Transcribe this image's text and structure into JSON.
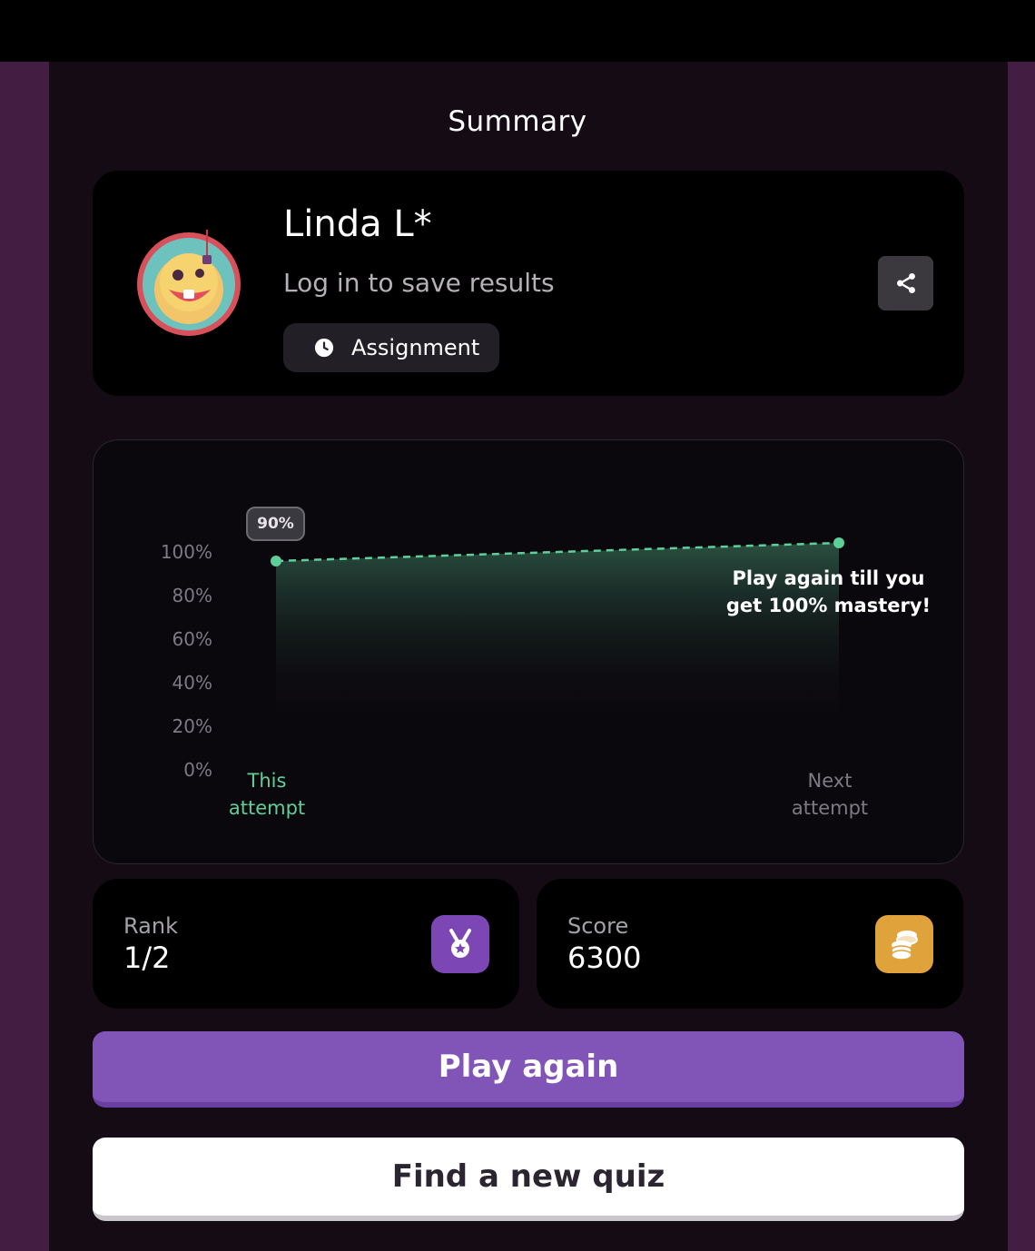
{
  "page": {
    "title": "Summary"
  },
  "profile": {
    "name": "Linda L*",
    "subtitle": "Log in to save results",
    "mode_label": "Assignment"
  },
  "chart_data": {
    "type": "area",
    "x": [
      "This attempt",
      "Next attempt"
    ],
    "series": [
      {
        "values": [
          90,
          100
        ]
      }
    ],
    "y_ticks": [
      "100%",
      "80%",
      "60%",
      "40%",
      "20%",
      "0%"
    ],
    "ylim": [
      0,
      100
    ],
    "point_label": "90%",
    "annotation": "Play again till you get 100% mastery!"
  },
  "stats": {
    "rank_label": "Rank",
    "rank_value": "1/2",
    "score_label": "Score",
    "score_value": "6300"
  },
  "actions": {
    "play_again": "Play again",
    "find_quiz": "Find a new quiz"
  },
  "colors": {
    "accent": "#8154b7",
    "line": "#5fcf9a",
    "coin": "#e0a23a"
  }
}
